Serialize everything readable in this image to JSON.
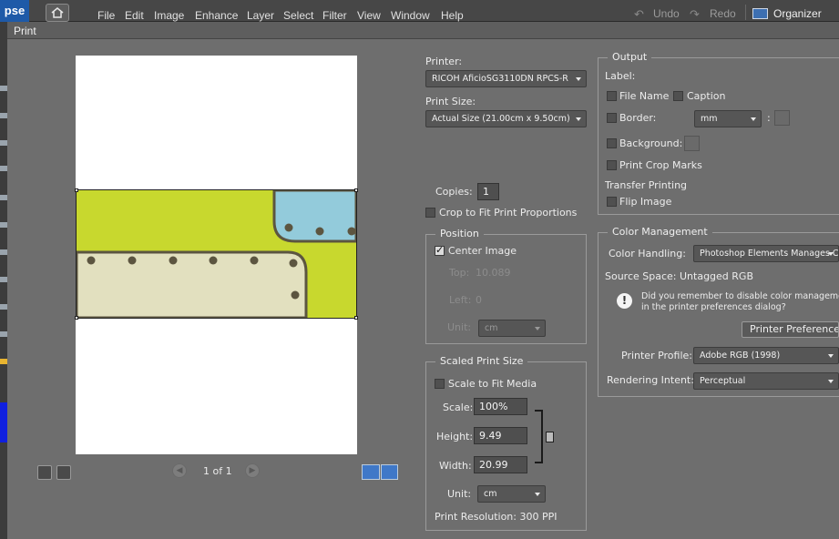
{
  "app": {
    "logo": "pse",
    "menu": [
      "File",
      "Edit",
      "Image",
      "Enhance",
      "Layer",
      "Select",
      "Filter",
      "View",
      "Window",
      "Help"
    ],
    "undo_label": "Undo",
    "redo_label": "Redo",
    "organizer_label": "Organizer"
  },
  "dialog": {
    "title": "Print"
  },
  "preview": {
    "page_indicator": "1 of 1",
    "image_colors": {
      "green": "#c8d82e",
      "blue": "#93cbdb",
      "cream": "#e2e0bf",
      "stitch": "#5c5540"
    }
  },
  "printer": {
    "label": "Printer:",
    "value": "RICOH AficioSG3110DN RPCS-R",
    "print_size_label": "Print Size:",
    "print_size_value": "Actual Size (21.00cm x 9.50cm)"
  },
  "copies": {
    "label": "Copies:",
    "value": "1"
  },
  "crop_to_fit": {
    "label": "Crop to Fit Print Proportions",
    "checked": false
  },
  "position": {
    "title": "Position",
    "center_image_label": "Center Image",
    "center_image_checked": true,
    "top_label": "Top:",
    "top_value": "10.089",
    "left_label": "Left:",
    "left_value": "0",
    "unit_label": "Unit:",
    "unit_value": "cm"
  },
  "scaled": {
    "title": "Scaled Print Size",
    "scale_to_fit_label": "Scale to Fit Media",
    "scale_to_fit_checked": false,
    "scale_label": "Scale:",
    "scale_value": "100%",
    "height_label": "Height:",
    "height_value": "9.49",
    "width_label": "Width:",
    "width_value": "20.99",
    "unit_label": "Unit:",
    "unit_value": "cm",
    "resolution": "Print Resolution: 300 PPI"
  },
  "output": {
    "title": "Output",
    "label_heading": "Label:",
    "file_name_label": "File Name",
    "caption_label": "Caption",
    "border_label": "Border:",
    "border_unit": "mm",
    "border_colon": ":",
    "background_label": "Background:",
    "crop_marks_label": "Print Crop Marks",
    "transfer_heading": "Transfer Printing",
    "flip_image_label": "Flip Image"
  },
  "color_mgmt": {
    "title": "Color Management",
    "handling_label": "Color Handling:",
    "handling_value": "Photoshop Elements Manages Colors",
    "source_space_label": "Source Space:",
    "source_space_value": "Untagged RGB",
    "info_text_line1": "Did you remember to disable color management",
    "info_text_line2": "in the printer preferences dialog?",
    "printer_prefs_button": "Printer Preferences",
    "printer_profile_label": "Printer Profile:",
    "printer_profile_value": "Adobe RGB (1998)",
    "rendering_intent_label": "Rendering Intent:",
    "rendering_intent_value": "Perceptual"
  }
}
